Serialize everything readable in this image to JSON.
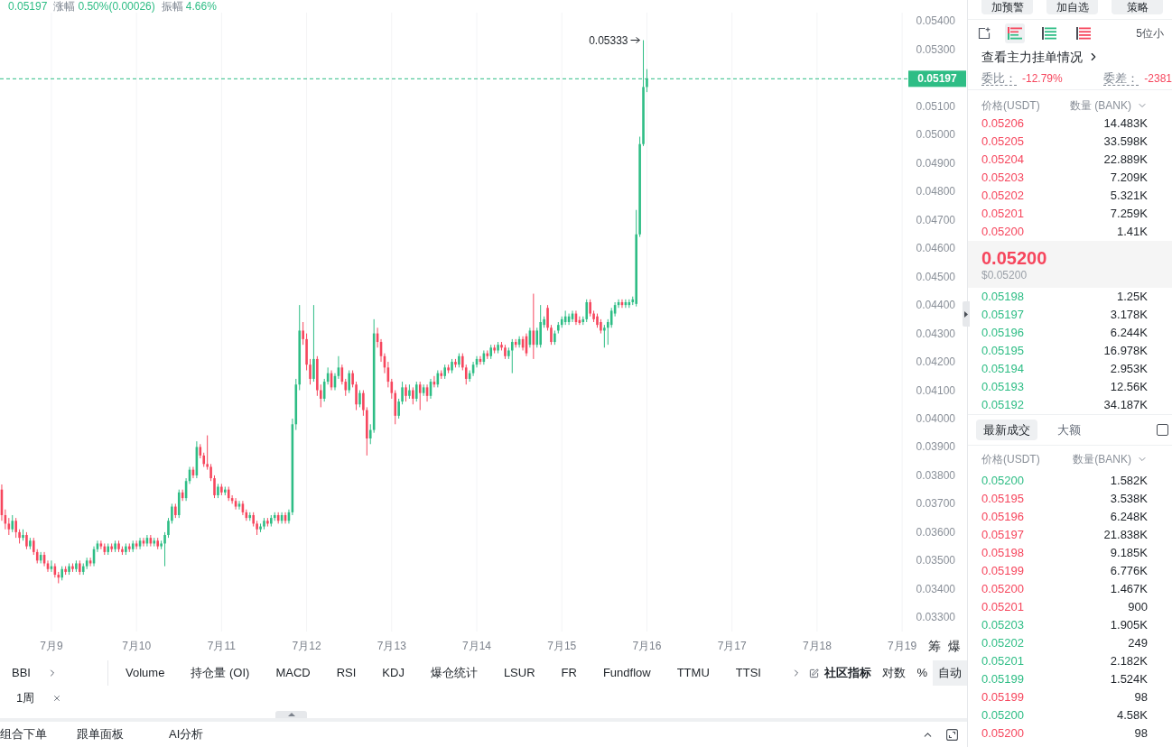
{
  "ticker_stats": [
    {
      "value": "0.05197"
    },
    {
      "label": "涨幅",
      "value": "0.50%(0.00026)"
    },
    {
      "label": "振幅",
      "value": "4.66%"
    }
  ],
  "chart": {
    "tool_buttons": [
      "筹",
      "爆"
    ],
    "chart_data": [
      {
        "type": "candlestick",
        "grid": "x",
        "xlim": [
          "--07-08T09:30",
          "--07-19T01:30"
        ],
        "ylim": [
          0.0325,
          0.0543
        ],
        "xticks": [
          {
            "value": "--07-09",
            "label": "7月9"
          },
          {
            "value": "--07-10",
            "label": "7月10"
          },
          {
            "value": "--07-11",
            "label": "7月11"
          },
          {
            "value": "--07-12",
            "label": "7月12"
          },
          {
            "value": "--07-13",
            "label": "7月13"
          },
          {
            "value": "--07-14",
            "label": "7月14"
          },
          {
            "value": "--07-15",
            "label": "7月15"
          },
          {
            "value": "--07-16",
            "label": "7月16"
          },
          {
            "value": "--07-17",
            "label": "7月17"
          },
          {
            "value": "--07-18",
            "label": "7月18"
          },
          {
            "value": "--07-19",
            "label": "7月19"
          }
        ],
        "yticks": [
          {
            "value": 0.054,
            "label": "0.05400"
          },
          {
            "value": 0.053,
            "label": "0.05300"
          },
          {
            "value": 0.051,
            "label": "0.05100"
          },
          {
            "value": 0.05,
            "label": "0.05000"
          },
          {
            "value": 0.049,
            "label": "0.04900"
          },
          {
            "value": 0.048,
            "label": "0.04800"
          },
          {
            "value": 0.047,
            "label": "0.04700"
          },
          {
            "value": 0.046,
            "label": "0.04600"
          },
          {
            "value": 0.045,
            "label": "0.04500"
          },
          {
            "value": 0.044,
            "label": "0.04400"
          },
          {
            "value": 0.043,
            "label": "0.04300"
          },
          {
            "value": 0.042,
            "label": "0.04200"
          },
          {
            "value": 0.041,
            "label": "0.04100"
          },
          {
            "value": 0.04,
            "label": "0.04000"
          },
          {
            "value": 0.039,
            "label": "0.03900"
          },
          {
            "value": 0.038,
            "label": "0.03800"
          },
          {
            "value": 0.037,
            "label": "0.03700"
          },
          {
            "value": 0.036,
            "label": "0.03600"
          },
          {
            "value": 0.035,
            "label": "0.03500"
          },
          {
            "value": 0.034,
            "label": "0.03400"
          },
          {
            "value": 0.033,
            "label": "0.03300"
          }
        ],
        "ref_lines": [
          {
            "axis": "y",
            "value": 0.05197,
            "label": "0.05197",
            "color": "#2ebd85",
            "line_style": "dashed"
          }
        ],
        "annotations": [
          "0.05333"
        ],
        "x": [
          "--07-08T10:00",
          "--07-08T11:00",
          "--07-08T12:00",
          "--07-08T13:00",
          "--07-08T14:00",
          "--07-08T15:00",
          "--07-08T16:00",
          "--07-08T17:00",
          "--07-08T18:00",
          "--07-08T19:00",
          "--07-08T20:00",
          "--07-08T21:00",
          "--07-08T22:00",
          "--07-08T23:00",
          "--07-09T00:00",
          "--07-09T01:00",
          "--07-09T02:00",
          "--07-09T03:00",
          "--07-09T04:00",
          "--07-09T05:00",
          "--07-09T06:00",
          "--07-09T07:00",
          "--07-09T08:00",
          "--07-09T09:00",
          "--07-09T10:00",
          "--07-09T11:00",
          "--07-09T12:00",
          "--07-09T13:00",
          "--07-09T14:00",
          "--07-09T15:00",
          "--07-09T16:00",
          "--07-09T17:00",
          "--07-09T18:00",
          "--07-09T19:00",
          "--07-09T20:00",
          "--07-09T21:00",
          "--07-09T22:00",
          "--07-09T23:00",
          "--07-10T00:00",
          "--07-10T01:00",
          "--07-10T02:00",
          "--07-10T03:00",
          "--07-10T04:00",
          "--07-10T05:00",
          "--07-10T06:00",
          "--07-10T07:00",
          "--07-10T08:00",
          "--07-10T09:00",
          "--07-10T10:00",
          "--07-10T11:00",
          "--07-10T12:00",
          "--07-10T13:00",
          "--07-10T14:00",
          "--07-10T15:00",
          "--07-10T16:00",
          "--07-10T17:00",
          "--07-10T18:00",
          "--07-10T19:00",
          "--07-10T20:00",
          "--07-10T21:00",
          "--07-10T22:00",
          "--07-10T23:00",
          "--07-11T00:00",
          "--07-11T01:00",
          "--07-11T02:00",
          "--07-11T03:00",
          "--07-11T04:00",
          "--07-11T05:00",
          "--07-11T06:00",
          "--07-11T07:00",
          "--07-11T08:00",
          "--07-11T09:00",
          "--07-11T10:00",
          "--07-11T11:00",
          "--07-11T12:00",
          "--07-11T13:00",
          "--07-11T14:00",
          "--07-11T15:00",
          "--07-11T16:00",
          "--07-11T17:00",
          "--07-11T18:00",
          "--07-11T19:00",
          "--07-11T20:00",
          "--07-11T21:00",
          "--07-11T22:00",
          "--07-11T23:00",
          "--07-12T00:00",
          "--07-12T01:00",
          "--07-12T02:00",
          "--07-12T03:00",
          "--07-12T04:00",
          "--07-12T05:00",
          "--07-12T06:00",
          "--07-12T07:00",
          "--07-12T08:00",
          "--07-12T09:00",
          "--07-12T10:00",
          "--07-12T11:00",
          "--07-12T12:00",
          "--07-12T13:00",
          "--07-12T14:00",
          "--07-12T15:00",
          "--07-12T16:00",
          "--07-12T17:00",
          "--07-12T18:00",
          "--07-12T19:00",
          "--07-12T20:00",
          "--07-12T21:00",
          "--07-12T22:00",
          "--07-12T23:00",
          "--07-13T00:00",
          "--07-13T01:00",
          "--07-13T02:00",
          "--07-13T03:00",
          "--07-13T04:00",
          "--07-13T05:00",
          "--07-13T06:00",
          "--07-13T07:00",
          "--07-13T08:00",
          "--07-13T09:00",
          "--07-13T10:00",
          "--07-13T11:00",
          "--07-13T12:00",
          "--07-13T13:00",
          "--07-13T14:00",
          "--07-13T15:00",
          "--07-13T16:00",
          "--07-13T17:00",
          "--07-13T18:00",
          "--07-13T19:00",
          "--07-13T20:00",
          "--07-13T21:00",
          "--07-13T22:00",
          "--07-13T23:00",
          "--07-14T00:00",
          "--07-14T01:00",
          "--07-14T02:00",
          "--07-14T03:00",
          "--07-14T04:00",
          "--07-14T05:00",
          "--07-14T06:00",
          "--07-14T07:00",
          "--07-14T08:00",
          "--07-14T09:00",
          "--07-14T10:00",
          "--07-14T11:00",
          "--07-14T12:00",
          "--07-14T13:00",
          "--07-14T14:00",
          "--07-14T15:00",
          "--07-14T16:00",
          "--07-14T17:00",
          "--07-14T18:00",
          "--07-14T19:00",
          "--07-14T20:00",
          "--07-14T21:00",
          "--07-14T22:00",
          "--07-14T23:00",
          "--07-15T00:00",
          "--07-15T01:00",
          "--07-15T02:00",
          "--07-15T03:00",
          "--07-15T04:00",
          "--07-15T05:00",
          "--07-15T06:00",
          "--07-15T07:00",
          "--07-15T08:00",
          "--07-15T09:00",
          "--07-15T10:00",
          "--07-15T11:00",
          "--07-15T12:00",
          "--07-15T13:00",
          "--07-15T14:00",
          "--07-15T15:00",
          "--07-15T16:00",
          "--07-15T17:00",
          "--07-15T18:00",
          "--07-15T19:00",
          "--07-15T20:00",
          "--07-15T21:00",
          "--07-15T22:00",
          "--07-15T23:00",
          "--07-16T00:00"
        ],
        "ohlc": [
          [
            0.0375,
            0.03768,
            0.0364,
            0.0366
          ],
          [
            0.0366,
            0.0368,
            0.0361,
            0.0363
          ],
          [
            0.0363,
            0.0365,
            0.0359,
            0.0361
          ],
          [
            0.0361,
            0.0366,
            0.036,
            0.0364
          ],
          [
            0.0364,
            0.0365,
            0.0358,
            0.036
          ],
          [
            0.036,
            0.0361,
            0.0356,
            0.0358
          ],
          [
            0.0358,
            0.0361,
            0.0357,
            0.0359
          ],
          [
            0.0359,
            0.036,
            0.0354,
            0.0355
          ],
          [
            0.0355,
            0.0358,
            0.0354,
            0.0357
          ],
          [
            0.0357,
            0.0358,
            0.0352,
            0.0353
          ],
          [
            0.0353,
            0.0354,
            0.0349,
            0.035
          ],
          [
            0.035,
            0.0353,
            0.0349,
            0.0352
          ],
          [
            0.0352,
            0.0353,
            0.0348,
            0.0349
          ],
          [
            0.0349,
            0.035,
            0.0346,
            0.0347
          ],
          [
            0.0347,
            0.035,
            0.0346,
            0.0348
          ],
          [
            0.0348,
            0.0349,
            0.0344,
            0.0345
          ],
          [
            0.0345,
            0.0346,
            0.0342,
            0.0344
          ],
          [
            0.0344,
            0.0348,
            0.0343,
            0.0347
          ],
          [
            0.0347,
            0.0348,
            0.0345,
            0.0346
          ],
          [
            0.0346,
            0.0349,
            0.0345,
            0.0348
          ],
          [
            0.0348,
            0.0349,
            0.0346,
            0.0347
          ],
          [
            0.0347,
            0.035,
            0.0346,
            0.0349
          ],
          [
            0.0349,
            0.035,
            0.0345,
            0.0346
          ],
          [
            0.0346,
            0.0349,
            0.0345,
            0.0348
          ],
          [
            0.0348,
            0.0351,
            0.0347,
            0.035
          ],
          [
            0.035,
            0.0351,
            0.0348,
            0.0349
          ],
          [
            0.0349,
            0.0355,
            0.0348,
            0.0354
          ],
          [
            0.0354,
            0.0357,
            0.0353,
            0.0356
          ],
          [
            0.0356,
            0.0357,
            0.0354,
            0.0355
          ],
          [
            0.0355,
            0.0356,
            0.0352,
            0.0353
          ],
          [
            0.0353,
            0.0356,
            0.0352,
            0.0355
          ],
          [
            0.0355,
            0.0356,
            0.0353,
            0.0354
          ],
          [
            0.0354,
            0.0357,
            0.0353,
            0.0356
          ],
          [
            0.0356,
            0.0357,
            0.0353,
            0.0354
          ],
          [
            0.0354,
            0.0355,
            0.0352,
            0.0353
          ],
          [
            0.0353,
            0.0356,
            0.0352,
            0.0355
          ],
          [
            0.0355,
            0.0356,
            0.0353,
            0.0354
          ],
          [
            0.0354,
            0.0357,
            0.0353,
            0.0356
          ],
          [
            0.0356,
            0.0357,
            0.0354,
            0.0355
          ],
          [
            0.0355,
            0.0358,
            0.0354,
            0.0357
          ],
          [
            0.0357,
            0.0358,
            0.0355,
            0.0356
          ],
          [
            0.0356,
            0.0359,
            0.0355,
            0.0358
          ],
          [
            0.0358,
            0.0359,
            0.0355,
            0.0356
          ],
          [
            0.0356,
            0.0358,
            0.0355,
            0.0357
          ],
          [
            0.0357,
            0.0358,
            0.0354,
            0.0355
          ],
          [
            0.0355,
            0.0357,
            0.0354,
            0.0356
          ],
          [
            0.0356,
            0.036,
            0.0348,
            0.0359
          ],
          [
            0.0359,
            0.0365,
            0.0358,
            0.0364
          ],
          [
            0.0364,
            0.037,
            0.0363,
            0.0369
          ],
          [
            0.0369,
            0.037,
            0.0365,
            0.0366
          ],
          [
            0.0366,
            0.0375,
            0.0365,
            0.0374
          ],
          [
            0.0374,
            0.0375,
            0.0371,
            0.0372
          ],
          [
            0.0372,
            0.0379,
            0.0371,
            0.0378
          ],
          [
            0.0378,
            0.0383,
            0.0377,
            0.0382
          ],
          [
            0.0382,
            0.0383,
            0.0379,
            0.038
          ],
          [
            0.038,
            0.0392,
            0.0379,
            0.039
          ],
          [
            0.039,
            0.0391,
            0.0386,
            0.0387
          ],
          [
            0.0387,
            0.0388,
            0.0383,
            0.0384
          ],
          [
            0.0384,
            0.03941,
            0.0382,
            0.0383
          ],
          [
            0.0383,
            0.0384,
            0.0378,
            0.0379
          ],
          [
            0.0379,
            0.038,
            0.0372,
            0.0373
          ],
          [
            0.0373,
            0.0377,
            0.0372,
            0.0376
          ],
          [
            0.0376,
            0.0377,
            0.0373,
            0.0374
          ],
          [
            0.0374,
            0.0376,
            0.0373,
            0.0375
          ],
          [
            0.0375,
            0.0376,
            0.0371,
            0.0372
          ],
          [
            0.0372,
            0.0373,
            0.037,
            0.0371
          ],
          [
            0.0371,
            0.0372,
            0.0368,
            0.0369
          ],
          [
            0.0369,
            0.0371,
            0.0368,
            0.037
          ],
          [
            0.037,
            0.0371,
            0.0366,
            0.0367
          ],
          [
            0.0367,
            0.0368,
            0.0364,
            0.0365
          ],
          [
            0.0365,
            0.0367,
            0.0364,
            0.0366
          ],
          [
            0.0366,
            0.0367,
            0.0362,
            0.0363
          ],
          [
            0.0363,
            0.0364,
            0.0359,
            0.0361
          ],
          [
            0.0361,
            0.0363,
            0.036,
            0.0362
          ],
          [
            0.0362,
            0.0365,
            0.0361,
            0.0364
          ],
          [
            0.0364,
            0.0365,
            0.0362,
            0.0363
          ],
          [
            0.0363,
            0.0366,
            0.0362,
            0.0365
          ],
          [
            0.0365,
            0.0367,
            0.0364,
            0.0366
          ],
          [
            0.0366,
            0.0367,
            0.0363,
            0.0364
          ],
          [
            0.0364,
            0.0367,
            0.0363,
            0.0366
          ],
          [
            0.0366,
            0.0367,
            0.0363,
            0.0364
          ],
          [
            0.0364,
            0.0368,
            0.0363,
            0.0367
          ],
          [
            0.0367,
            0.04,
            0.0366,
            0.0398
          ],
          [
            0.0398,
            0.0414,
            0.0396,
            0.0412
          ],
          [
            0.0412,
            0.044,
            0.041,
            0.0431
          ],
          [
            0.0431,
            0.0434,
            0.0426,
            0.0428
          ],
          [
            0.0428,
            0.043,
            0.0417,
            0.0419
          ],
          [
            0.0419,
            0.0421,
            0.0412,
            0.0414
          ],
          [
            0.0414,
            0.044,
            0.0413,
            0.0421
          ],
          [
            0.0421,
            0.0422,
            0.0408,
            0.041
          ],
          [
            0.041,
            0.0412,
            0.0404,
            0.0407
          ],
          [
            0.0407,
            0.0414,
            0.0406,
            0.0413
          ],
          [
            0.0413,
            0.0418,
            0.0412,
            0.0416
          ],
          [
            0.0416,
            0.0417,
            0.041,
            0.0411
          ],
          [
            0.0411,
            0.0416,
            0.041,
            0.0415
          ],
          [
            0.0415,
            0.0422,
            0.0414,
            0.0418
          ],
          [
            0.0418,
            0.0419,
            0.0412,
            0.0413
          ],
          [
            0.0413,
            0.0414,
            0.0408,
            0.041
          ],
          [
            0.041,
            0.0417,
            0.0409,
            0.0416
          ],
          [
            0.0416,
            0.0417,
            0.0411,
            0.0412
          ],
          [
            0.0412,
            0.0413,
            0.0403,
            0.0405
          ],
          [
            0.0405,
            0.041,
            0.0404,
            0.0409
          ],
          [
            0.0409,
            0.041,
            0.0401,
            0.0403
          ],
          [
            0.0403,
            0.0404,
            0.0387,
            0.0393
          ],
          [
            0.0393,
            0.0398,
            0.0391,
            0.0396
          ],
          [
            0.0396,
            0.0435,
            0.0395,
            0.043
          ],
          [
            0.043,
            0.0432,
            0.0425,
            0.0427
          ],
          [
            0.0427,
            0.0428,
            0.042,
            0.0422
          ],
          [
            0.0422,
            0.0423,
            0.0416,
            0.0418
          ],
          [
            0.0418,
            0.042,
            0.0411,
            0.0413
          ],
          [
            0.0413,
            0.0414,
            0.0407,
            0.0409
          ],
          [
            0.0409,
            0.041,
            0.0398,
            0.0401
          ],
          [
            0.0401,
            0.0407,
            0.04,
            0.0406
          ],
          [
            0.0406,
            0.0413,
            0.0405,
            0.0411
          ],
          [
            0.0411,
            0.0412,
            0.0406,
            0.0408
          ],
          [
            0.0408,
            0.0412,
            0.0407,
            0.041
          ],
          [
            0.041,
            0.0411,
            0.0405,
            0.0407
          ],
          [
            0.0407,
            0.0413,
            0.0406,
            0.0412
          ],
          [
            0.0412,
            0.0413,
            0.0403,
            0.0409
          ],
          [
            0.0409,
            0.0412,
            0.0408,
            0.0411
          ],
          [
            0.0411,
            0.0412,
            0.0406,
            0.0408
          ],
          [
            0.0408,
            0.0414,
            0.0407,
            0.0413
          ],
          [
            0.0413,
            0.0415,
            0.0411,
            0.0412
          ],
          [
            0.0412,
            0.0417,
            0.0411,
            0.0416
          ],
          [
            0.0416,
            0.0417,
            0.0414,
            0.0415
          ],
          [
            0.0415,
            0.0419,
            0.0414,
            0.0418
          ],
          [
            0.0418,
            0.0419,
            0.0416,
            0.0417
          ],
          [
            0.0417,
            0.0421,
            0.0416,
            0.042
          ],
          [
            0.042,
            0.0421,
            0.0418,
            0.0419
          ],
          [
            0.0419,
            0.0423,
            0.0418,
            0.0422
          ],
          [
            0.0422,
            0.0423,
            0.0417,
            0.0418
          ],
          [
            0.0418,
            0.0419,
            0.0412,
            0.0414
          ],
          [
            0.0414,
            0.0417,
            0.0413,
            0.0416
          ],
          [
            0.0416,
            0.042,
            0.0415,
            0.0419
          ],
          [
            0.0419,
            0.0422,
            0.0418,
            0.0421
          ],
          [
            0.0421,
            0.0422,
            0.0419,
            0.042
          ],
          [
            0.042,
            0.0424,
            0.0419,
            0.0423
          ],
          [
            0.0423,
            0.0424,
            0.0421,
            0.0422
          ],
          [
            0.0422,
            0.0426,
            0.0421,
            0.0425
          ],
          [
            0.0425,
            0.0426,
            0.0423,
            0.0424
          ],
          [
            0.0424,
            0.0427,
            0.0423,
            0.0426
          ],
          [
            0.0426,
            0.0427,
            0.0424,
            0.0425
          ],
          [
            0.0425,
            0.0426,
            0.0421,
            0.0422
          ],
          [
            0.0422,
            0.0425,
            0.0421,
            0.0424
          ],
          [
            0.0424,
            0.0428,
            0.0416,
            0.0427
          ],
          [
            0.0427,
            0.0428,
            0.0425,
            0.0426
          ],
          [
            0.0426,
            0.0429,
            0.0425,
            0.0428
          ],
          [
            0.0428,
            0.0429,
            0.0424,
            0.0425
          ],
          [
            0.0429,
            0.043,
            0.0422,
            0.0423
          ],
          [
            0.0426,
            0.0432,
            0.0425,
            0.0431
          ],
          [
            0.0431,
            0.0444,
            0.0421,
            0.0426
          ],
          [
            0.0426,
            0.0432,
            0.0425,
            0.0431
          ],
          [
            0.0426,
            0.044,
            0.0425,
            0.0434
          ],
          [
            0.0433,
            0.0436,
            0.0432,
            0.0435
          ],
          [
            0.0439,
            0.044,
            0.0431,
            0.0432
          ],
          [
            0.0432,
            0.0433,
            0.0426,
            0.0427
          ],
          [
            0.0427,
            0.0431,
            0.0426,
            0.043
          ],
          [
            0.0431,
            0.0434,
            0.043,
            0.0433
          ],
          [
            0.0433,
            0.0436,
            0.0432,
            0.0435
          ],
          [
            0.0434,
            0.0438,
            0.0433,
            0.0436
          ],
          [
            0.0434,
            0.0437,
            0.0433,
            0.0436
          ],
          [
            0.0435,
            0.0438,
            0.0434,
            0.0437
          ],
          [
            0.0437,
            0.0438,
            0.0433,
            0.0434
          ],
          [
            0.04347,
            0.0436,
            0.0433,
            0.04337
          ],
          [
            0.0434,
            0.0436,
            0.0433,
            0.0435
          ],
          [
            0.0435,
            0.0442,
            0.0434,
            0.0441
          ],
          [
            0.0441,
            0.0442,
            0.0436,
            0.0437
          ],
          [
            0.0437,
            0.0438,
            0.0434,
            0.0435
          ],
          [
            0.0436,
            0.0437,
            0.0432,
            0.0433
          ],
          [
            0.0434,
            0.0435,
            0.043,
            0.0431
          ],
          [
            0.0431,
            0.0433,
            0.0425,
            0.0432
          ],
          [
            0.0432,
            0.0435,
            0.0426,
            0.0434
          ],
          [
            0.0433,
            0.0439,
            0.0432,
            0.0438
          ],
          [
            0.0437,
            0.0441,
            0.0436,
            0.044
          ],
          [
            0.044,
            0.0442,
            0.0439,
            0.0441
          ],
          [
            0.0441,
            0.0442,
            0.0439,
            0.044
          ],
          [
            0.044,
            0.0442,
            0.0439,
            0.0441
          ],
          [
            0.044,
            0.0442,
            0.0439,
            0.0441
          ],
          [
            0.0441,
            0.0443,
            0.044,
            0.0442
          ],
          [
            0.04404,
            0.04735,
            0.04395,
            0.04649
          ],
          [
            0.04649,
            0.04993,
            0.0464,
            0.04967
          ],
          [
            0.04967,
            0.05333,
            0.0496,
            0.05168
          ],
          [
            0.05168,
            0.05231,
            0.0515,
            0.05197
          ]
        ]
      }
    ]
  },
  "indicator_bar": {
    "main": [
      "BBI"
    ],
    "sub": [
      "Volume",
      "持仓量 (OI)",
      "MACD",
      "RSI",
      "KDJ",
      "爆仓统计",
      "LSUR",
      "FR",
      "Fundflow",
      "TTMU",
      "TTSI"
    ],
    "community": "社区指标",
    "scale_modes": [
      {
        "label": "对数",
        "selected": false
      },
      {
        "label": "%",
        "selected": false
      },
      {
        "label": "自动",
        "selected": true
      }
    ]
  },
  "period_tags": [
    "1周"
  ],
  "bottom_bar": {
    "tabs": [
      "组合下单",
      "跟单面板",
      "AI分析"
    ]
  },
  "order_panel": {
    "buttons": [
      "加预警",
      "加自选",
      "策略"
    ],
    "view_modes": [
      {
        "kind": "both",
        "selected": true
      },
      {
        "kind": "bids",
        "selected": false
      },
      {
        "kind": "asks",
        "selected": false
      }
    ],
    "precision": "5位小",
    "big_orders_link": "查看主力挂单情况",
    "ratio": {
      "label": "委比：",
      "value": "-12.79%"
    },
    "diff": {
      "label": "委差：",
      "value": "-2381"
    },
    "columns": [
      "价格(USDT)",
      "数量 (BANK)"
    ],
    "asks": [
      {
        "price": "0.05206",
        "qty": "14.483K"
      },
      {
        "price": "0.05205",
        "qty": "33.598K"
      },
      {
        "price": "0.05204",
        "qty": "22.889K"
      },
      {
        "price": "0.05203",
        "qty": "7.209K"
      },
      {
        "price": "0.05202",
        "qty": "5.321K"
      },
      {
        "price": "0.05201",
        "qty": "7.259K"
      },
      {
        "price": "0.05200",
        "qty": "1.41K"
      }
    ],
    "last_price": {
      "value": "0.05200",
      "usd": "$0.05200",
      "color": "#f6465d"
    },
    "bids": [
      {
        "price": "0.05198",
        "qty": "1.25K"
      },
      {
        "price": "0.05197",
        "qty": "3.178K"
      },
      {
        "price": "0.05196",
        "qty": "6.244K"
      },
      {
        "price": "0.05195",
        "qty": "16.978K"
      },
      {
        "price": "0.05194",
        "qty": "2.953K"
      },
      {
        "price": "0.05193",
        "qty": "12.56K"
      },
      {
        "price": "0.05192",
        "qty": "34.187K"
      }
    ]
  },
  "trades_panel": {
    "tabs": [
      {
        "label": "最新成交",
        "selected": true
      },
      {
        "label": "大额",
        "selected": false
      }
    ],
    "large_filter": {
      "checked": false
    },
    "columns": [
      "价格(USDT)",
      "数量(BANK)"
    ],
    "rows": [
      {
        "price": "0.05200",
        "qty": "1.582K",
        "color": "#2ebd85"
      },
      {
        "price": "0.05195",
        "qty": "3.538K",
        "color": "#f6465d"
      },
      {
        "price": "0.05196",
        "qty": "6.248K",
        "color": "#f6465d"
      },
      {
        "price": "0.05197",
        "qty": "21.838K",
        "color": "#f6465d"
      },
      {
        "price": "0.05198",
        "qty": "9.185K",
        "color": "#f6465d"
      },
      {
        "price": "0.05199",
        "qty": "6.776K",
        "color": "#f6465d"
      },
      {
        "price": "0.05200",
        "qty": "1.467K",
        "color": "#f6465d"
      },
      {
        "price": "0.05201",
        "qty": "900",
        "color": "#f6465d"
      },
      {
        "price": "0.05203",
        "qty": "1.905K",
        "color": "#2ebd85"
      },
      {
        "price": "0.05202",
        "qty": "249",
        "color": "#2ebd85"
      },
      {
        "price": "0.05201",
        "qty": "2.182K",
        "color": "#2ebd85"
      },
      {
        "price": "0.05199",
        "qty": "1.524K",
        "color": "#2ebd85"
      },
      {
        "price": "0.05199",
        "qty": "98",
        "color": "#f6465d"
      },
      {
        "price": "0.05200",
        "qty": "4.58K",
        "color": "#2ebd85"
      },
      {
        "price": "0.05200",
        "qty": "98",
        "color": "#f6465d"
      }
    ]
  }
}
